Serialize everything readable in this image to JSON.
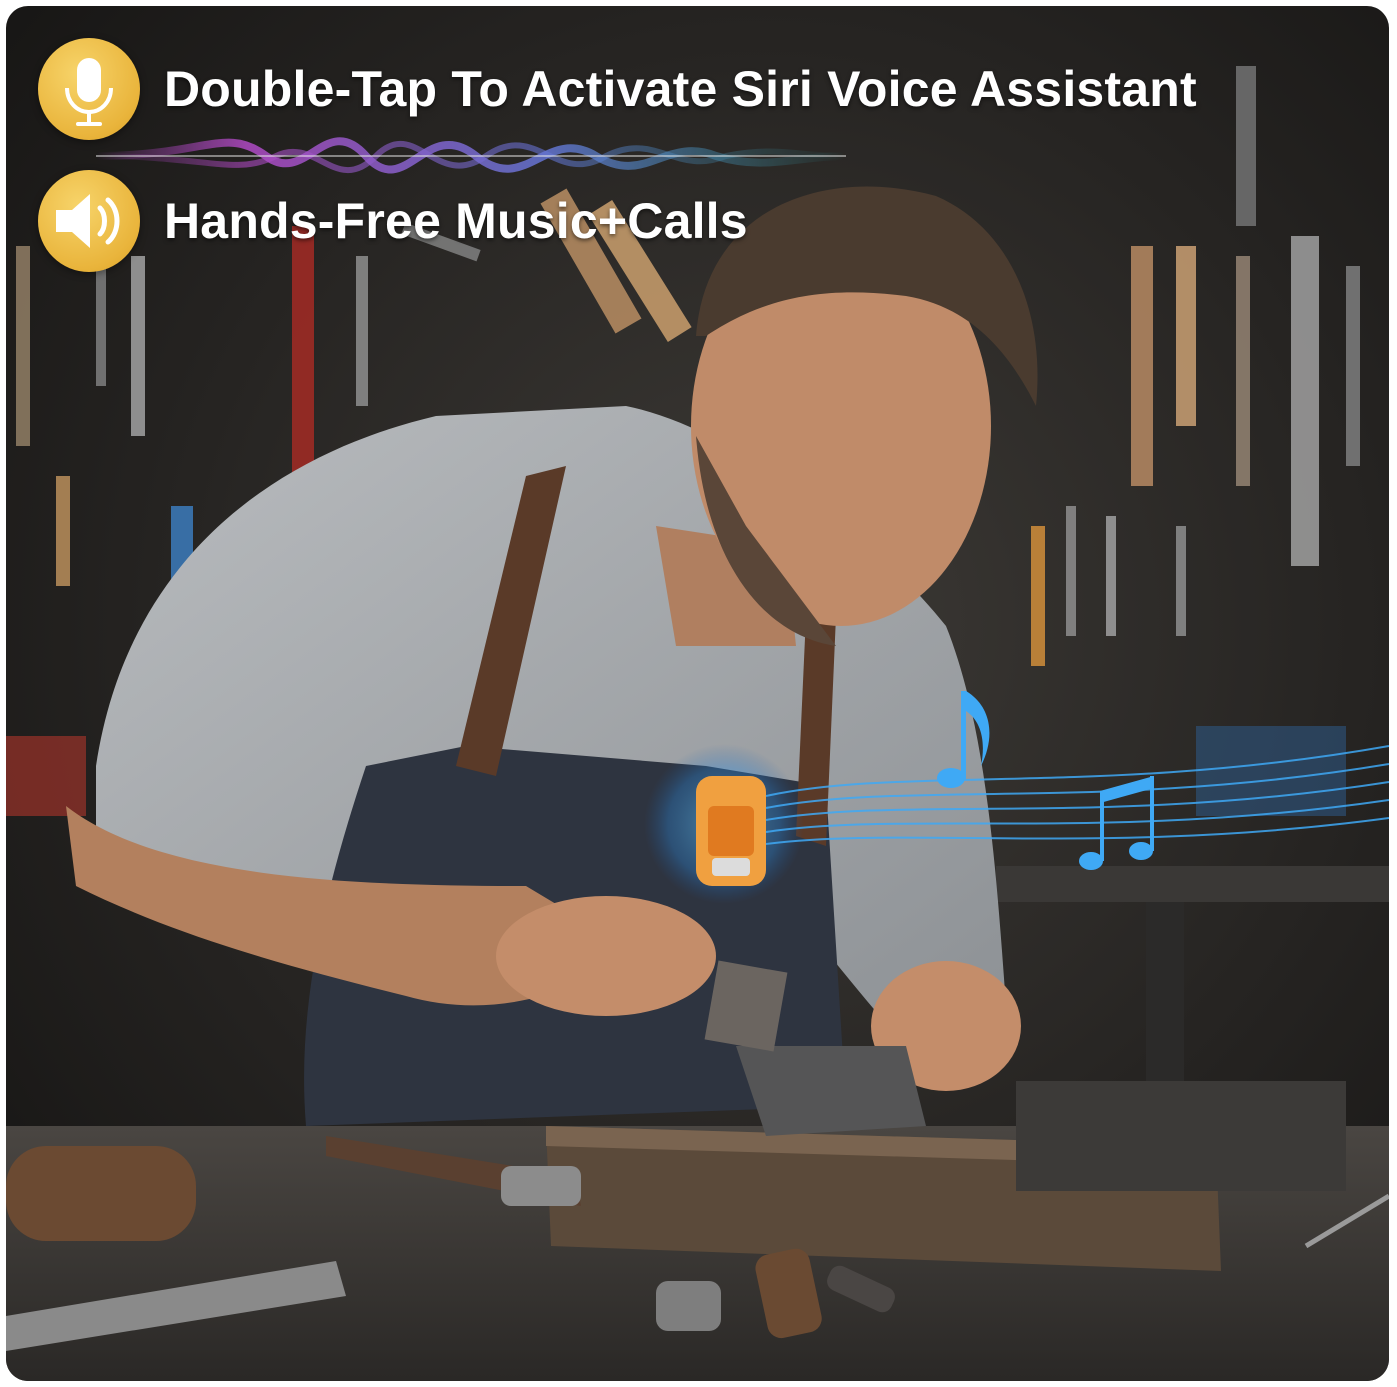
{
  "features": [
    {
      "text": "Double-Tap To Activate Siri Voice Assistant",
      "icon": "microphone-icon"
    },
    {
      "text": "Hands-Free Music+Calls",
      "icon": "speaker-icon"
    }
  ],
  "colors": {
    "badge": "#e9b43b",
    "wave_start": "#c04fd6",
    "wave_end": "#38d2d8",
    "music": "#3fa9f5",
    "device": "#f0a040"
  }
}
